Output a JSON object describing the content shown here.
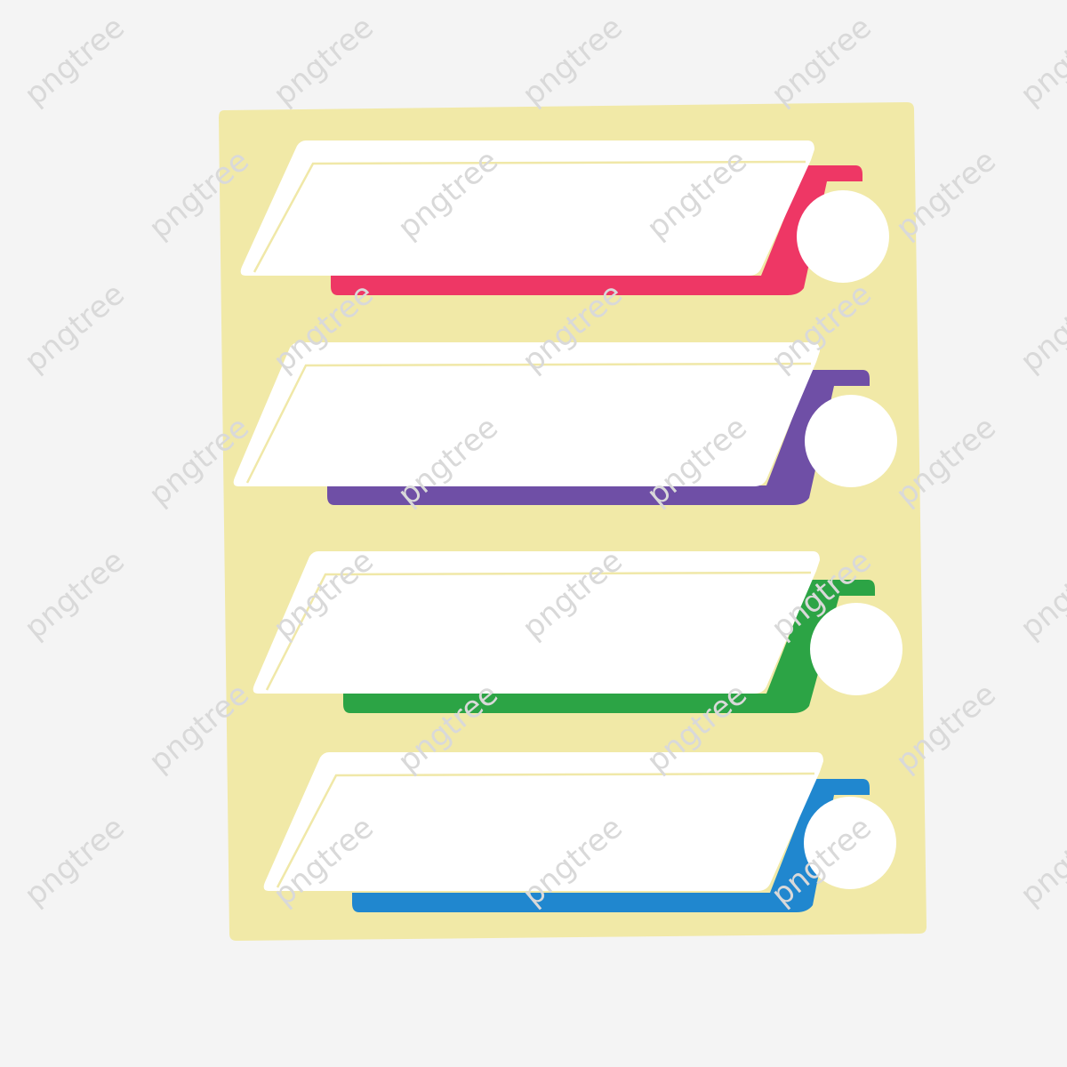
{
  "colors": {
    "background": "#f4f4f4",
    "card": "#f1e9a7",
    "label": "#ffffff",
    "label_inner_line": "#f0e8a8",
    "watermark": "#d9d9d9"
  },
  "banners": [
    {
      "name": "banner-1",
      "accent": "#ee3765"
    },
    {
      "name": "banner-2",
      "accent": "#6f4fa6"
    },
    {
      "name": "banner-3",
      "accent": "#2ca445"
    },
    {
      "name": "banner-4",
      "accent": "#2087cf"
    }
  ],
  "watermark": {
    "text": "pngtree"
  }
}
